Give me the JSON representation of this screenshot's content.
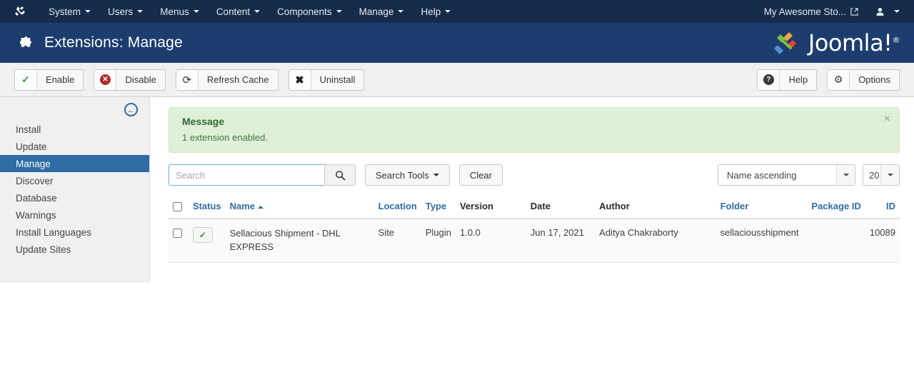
{
  "topnav": {
    "brand_icon": "joomla-mark-icon",
    "items": [
      {
        "label": "System",
        "caret": true
      },
      {
        "label": "Users",
        "caret": true
      },
      {
        "label": "Menus",
        "caret": true
      },
      {
        "label": "Content",
        "caret": true
      },
      {
        "label": "Components",
        "caret": true
      },
      {
        "label": "Manage",
        "caret": true
      },
      {
        "label": "Help",
        "caret": true
      }
    ],
    "site_name": "My Awesome Sto...",
    "site_icon": "external-link-icon",
    "user_icon": "user-icon"
  },
  "header": {
    "icon": "puzzle-piece-icon",
    "title": "Extensions: Manage",
    "logo_text": "Joomla!",
    "logo_sup": "®"
  },
  "toolbar": {
    "left": [
      {
        "label": "Enable",
        "icon": "check-icon"
      },
      {
        "label": "Disable",
        "icon": "circle-x-icon"
      },
      {
        "label": "Refresh Cache",
        "icon": "refresh-icon"
      },
      {
        "label": "Uninstall",
        "icon": "x-icon"
      }
    ],
    "right": [
      {
        "label": "Help",
        "icon": "question-circle-icon"
      },
      {
        "label": "Options",
        "icon": "gear-icon"
      }
    ]
  },
  "sidebar": {
    "collapse_icon": "arrow-circle-left-icon",
    "items": [
      {
        "label": "Install",
        "active": false
      },
      {
        "label": "Update",
        "active": false
      },
      {
        "label": "Manage",
        "active": true
      },
      {
        "label": "Discover",
        "active": false
      },
      {
        "label": "Database",
        "active": false
      },
      {
        "label": "Warnings",
        "active": false
      },
      {
        "label": "Install Languages",
        "active": false
      },
      {
        "label": "Update Sites",
        "active": false
      }
    ]
  },
  "alert": {
    "title": "Message",
    "text": "1 extension enabled.",
    "close_icon": "close-icon",
    "type": "success",
    "bg_color": "#dff0d8",
    "text_color": "#3c763d"
  },
  "filters": {
    "search_placeholder": "Search",
    "search_value": "",
    "search_icon": "search-icon",
    "search_tools_label": "Search Tools",
    "clear_label": "Clear",
    "sort_value": "Name ascending",
    "limit_value": "20"
  },
  "table": {
    "columns": [
      {
        "key": "check",
        "label": "",
        "link": false
      },
      {
        "key": "status",
        "label": "Status",
        "link": true
      },
      {
        "key": "name",
        "label": "Name",
        "link": true,
        "sorted": "asc"
      },
      {
        "key": "location",
        "label": "Location",
        "link": true
      },
      {
        "key": "type",
        "label": "Type",
        "link": true
      },
      {
        "key": "version",
        "label": "Version",
        "link": false
      },
      {
        "key": "date",
        "label": "Date",
        "link": false
      },
      {
        "key": "author",
        "label": "Author",
        "link": false
      },
      {
        "key": "folder",
        "label": "Folder",
        "link": true
      },
      {
        "key": "package_id",
        "label": "Package ID",
        "link": true
      },
      {
        "key": "id",
        "label": "ID",
        "link": true
      }
    ],
    "rows": [
      {
        "status_icon": "check-icon",
        "status_enabled": true,
        "name": "Sellacious Shipment - DHL EXPRESS",
        "location": "Site",
        "type": "Plugin",
        "version": "1.0.0",
        "date": "Jun 17, 2021",
        "author": "Aditya Chakraborty",
        "folder": "sellaciousshipment",
        "package_id": "",
        "id": "10089"
      }
    ]
  },
  "colors": {
    "topnav_bg": "#142b4a",
    "header_bg": "#1c3d6e",
    "accent_link": "#2f6ca5",
    "sidebar_active": "#2f6ca5"
  }
}
